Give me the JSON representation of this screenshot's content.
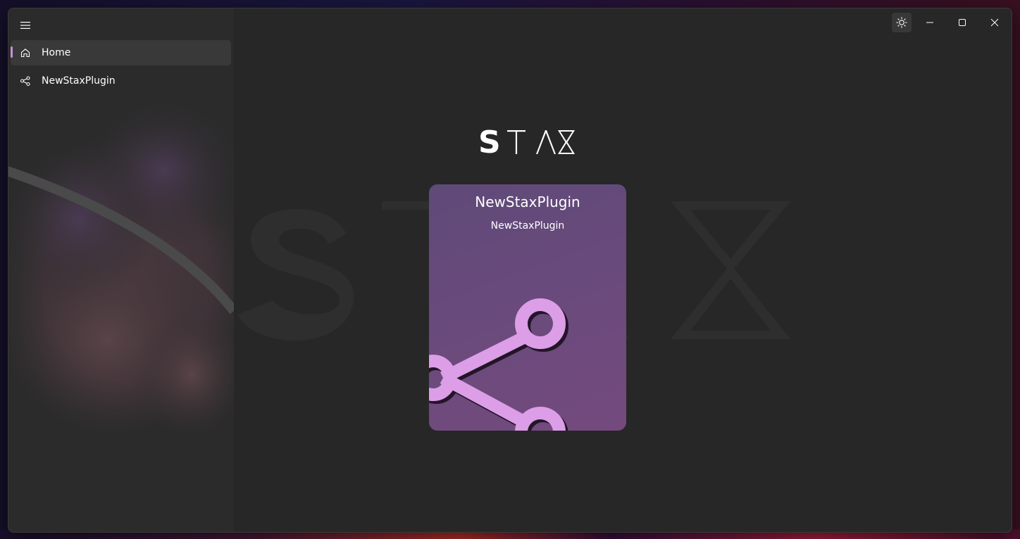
{
  "app": {
    "title": "Stax"
  },
  "sidebar": {
    "menu_icon": "hamburger-menu-icon",
    "items": [
      {
        "label": "Home",
        "icon": "home-icon",
        "selected": true
      },
      {
        "label": "NewStaxPlugin",
        "icon": "share-icon",
        "selected": false
      }
    ]
  },
  "titlebar": {
    "buttons": [
      {
        "name": "theme-toggle",
        "icon": "sun-icon"
      },
      {
        "name": "minimize",
        "icon": "minimize-icon"
      },
      {
        "name": "maximize",
        "icon": "maximize-icon"
      },
      {
        "name": "close",
        "icon": "close-icon"
      }
    ]
  },
  "main": {
    "logo_text": "STAX",
    "plugin_card": {
      "title": "NewStaxPlugin",
      "subtitle": "NewStaxPlugin",
      "icon": "share-icon"
    }
  },
  "colors": {
    "accent": "#c792d6",
    "card_background": "#6a4a7c",
    "card_icon": "#dc9ee6",
    "window_background": "#272727",
    "sidebar_background": "#2b2b2b"
  }
}
